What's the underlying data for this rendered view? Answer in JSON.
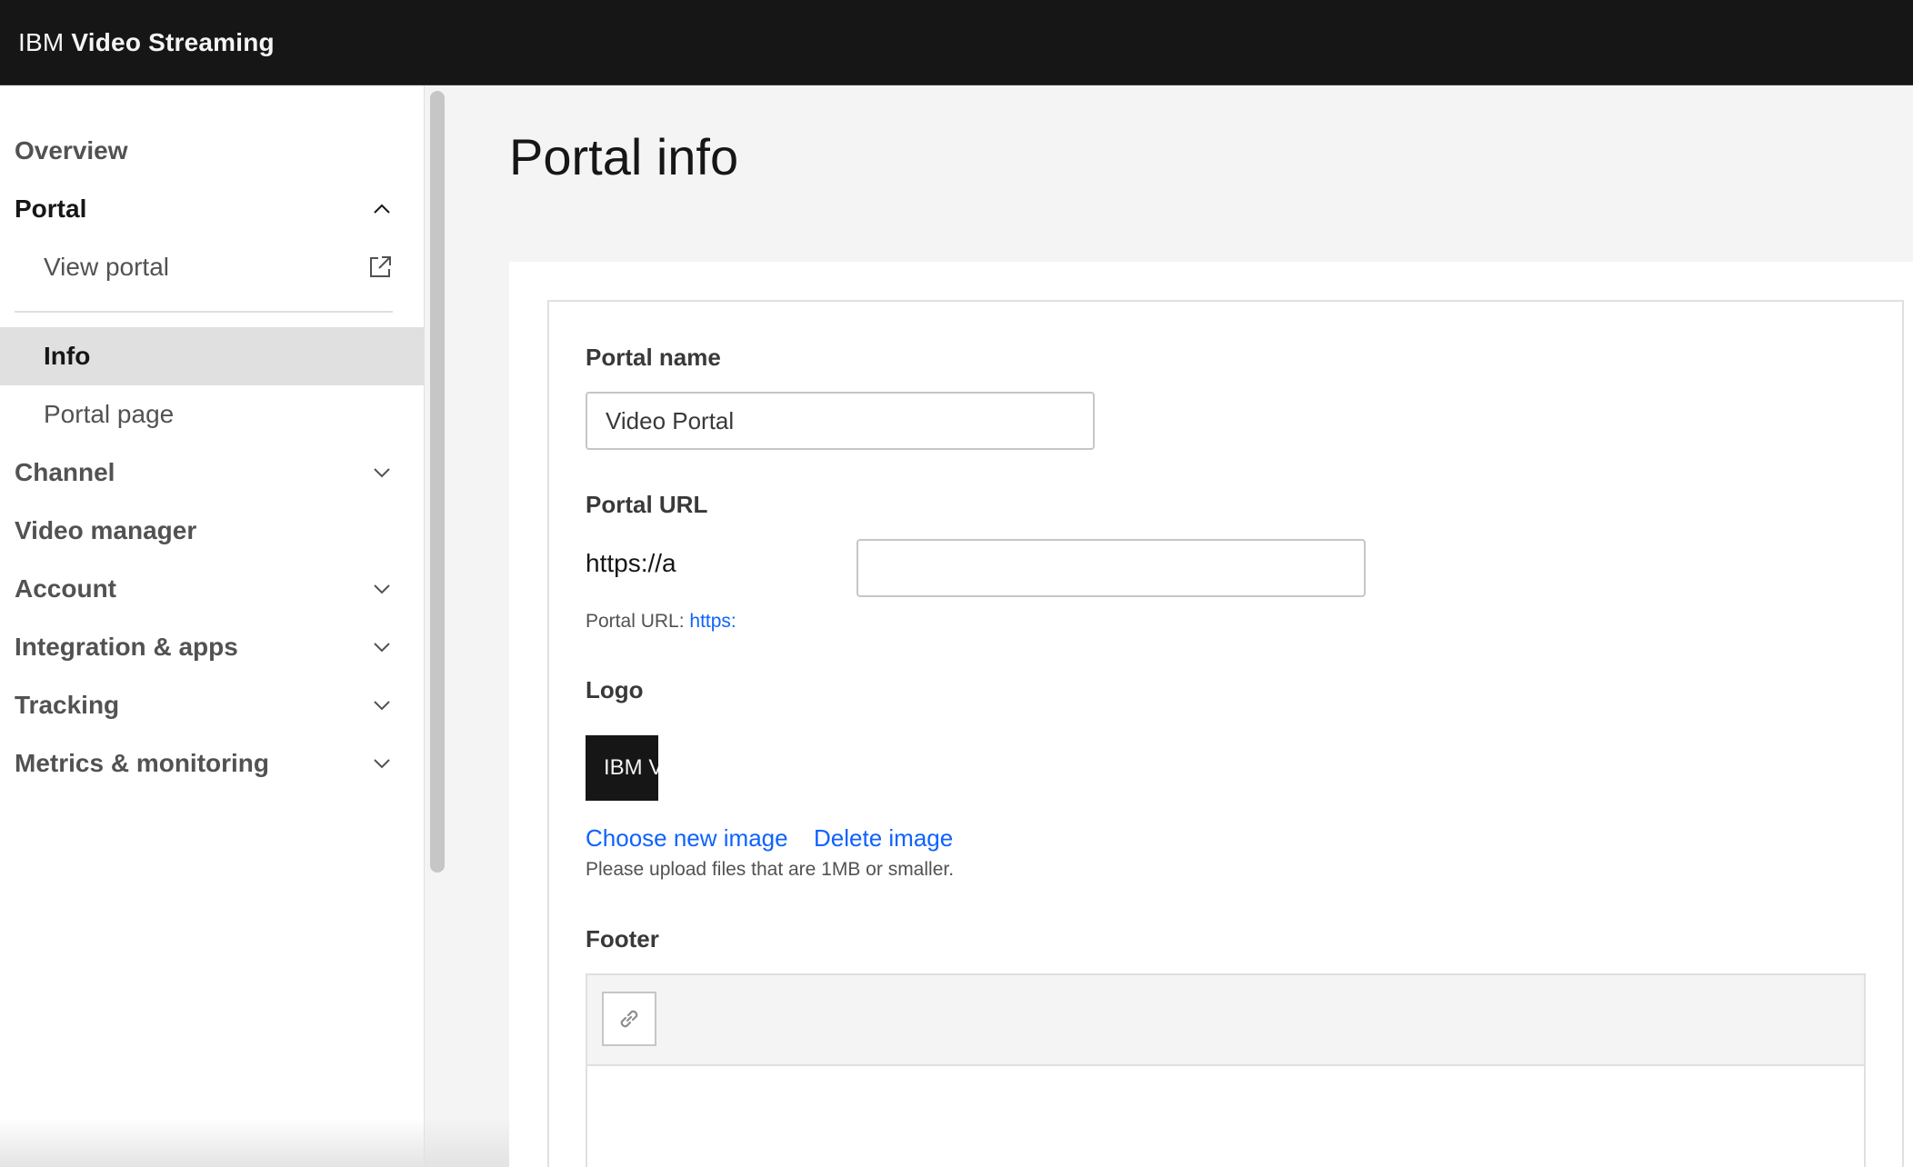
{
  "header": {
    "brand_prefix": "IBM",
    "brand_name": "Video Streaming"
  },
  "sidebar": {
    "items": [
      {
        "label": "Overview"
      },
      {
        "label": "Portal"
      },
      {
        "label": "View portal"
      },
      {
        "label": "Info"
      },
      {
        "label": "Portal page"
      },
      {
        "label": "Channel"
      },
      {
        "label": "Video manager"
      },
      {
        "label": "Account"
      },
      {
        "label": "Integration & apps"
      },
      {
        "label": "Tracking"
      },
      {
        "label": "Metrics & monitoring"
      }
    ]
  },
  "main": {
    "title": "Portal info",
    "portal_name": {
      "label": "Portal name",
      "value": "Video Portal"
    },
    "portal_url": {
      "label": "Portal URL",
      "prefix": "https://a",
      "helper_label": "Portal URL:",
      "helper_link": "https:"
    },
    "logo": {
      "label": "Logo",
      "preview_text": "IBM V",
      "choose_label": "Choose new image",
      "delete_label": "Delete image",
      "helper": "Please upload files that are 1MB or smaller."
    },
    "footer": {
      "label": "Footer"
    }
  },
  "icons": {
    "chevron": "chevron-icon",
    "external_link": "external-link-icon",
    "link": "link-icon"
  },
  "colors": {
    "header_bg": "#161616",
    "link": "#0f62fe",
    "active_nav_bg": "#e0e0e0",
    "page_bg": "#f4f4f4"
  }
}
